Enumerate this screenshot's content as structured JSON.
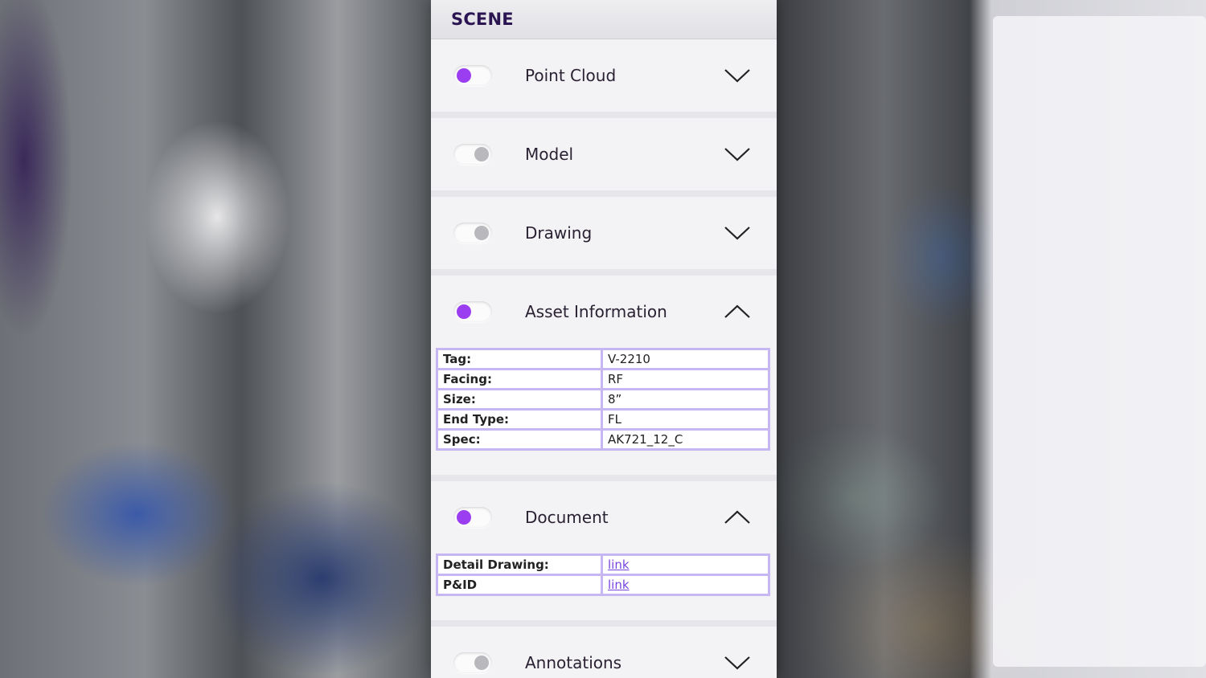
{
  "panel": {
    "title": "SCENE"
  },
  "sections": {
    "point_cloud": {
      "label": "Point Cloud",
      "enabled": true,
      "expanded": false
    },
    "model": {
      "label": "Model",
      "enabled": false,
      "expanded": false
    },
    "drawing": {
      "label": "Drawing",
      "enabled": false,
      "expanded": false
    },
    "asset_information": {
      "label": "Asset Information",
      "enabled": true,
      "expanded": true,
      "rows": [
        {
          "key": "Tag:",
          "value": "V-2210"
        },
        {
          "key": "Facing:",
          "value": "RF"
        },
        {
          "key": "Size:",
          "value": "8”"
        },
        {
          "key": "End Type:",
          "value": "FL"
        },
        {
          "key": "Spec:",
          "value": "AK721_12_C"
        }
      ]
    },
    "document": {
      "label": "Document",
      "enabled": true,
      "expanded": true,
      "rows": [
        {
          "key": "Detail Drawing:",
          "value": "link"
        },
        {
          "key": "P&ID",
          "value": "link"
        }
      ]
    },
    "annotations": {
      "label": "Annotations",
      "enabled": false,
      "expanded": false
    }
  },
  "colors": {
    "accent": "#9b3df0",
    "title": "#2b1552",
    "table_border": "#c6b7f2",
    "link": "#7a45e0"
  }
}
